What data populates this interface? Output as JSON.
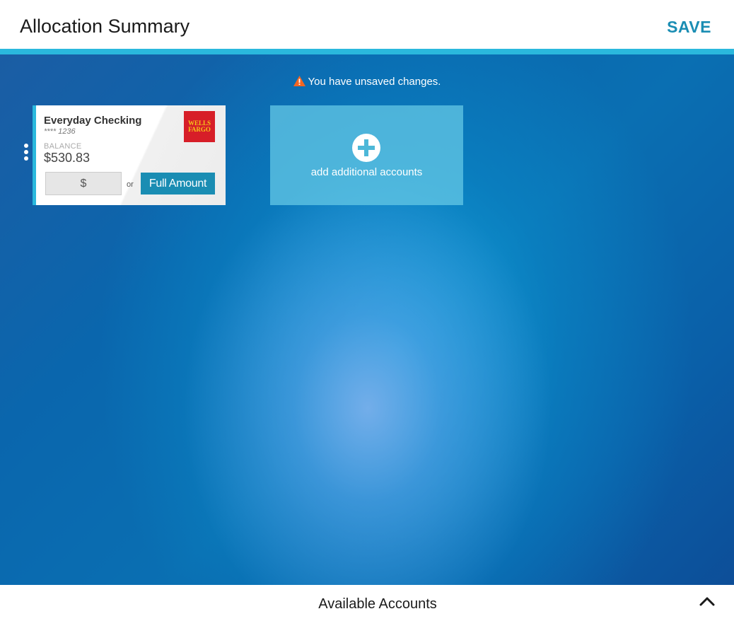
{
  "header": {
    "title": "Allocation Summary",
    "save_label": "SAVE"
  },
  "notice": {
    "icon": "warning-icon",
    "text": "You have unsaved changes."
  },
  "accounts": [
    {
      "name": "Everyday Checking",
      "number": "**** 1236",
      "balance_label": "BALANCE",
      "balance": "$530.83",
      "bank_logo_text": "WELLS FARGO",
      "amount_placeholder": "$",
      "or_label": "or",
      "full_amount_label": "Full Amount"
    }
  ],
  "add_tile": {
    "icon": "plus-circle-icon",
    "label": "add additional accounts"
  },
  "footer": {
    "title": "Available Accounts",
    "icon": "chevron-up-icon"
  },
  "colors": {
    "accent": "#2ab8dd",
    "primary_button": "#1a8db3",
    "warning": "#f26522",
    "bank_logo": "#d71e28"
  }
}
